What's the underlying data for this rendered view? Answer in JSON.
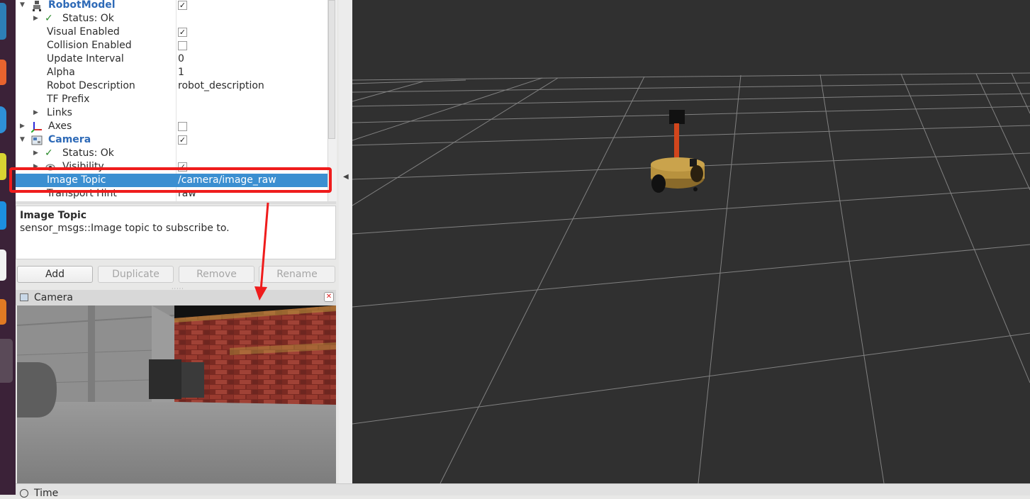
{
  "displays": {
    "rows": [
      {
        "indent": 0,
        "expanded": true,
        "name": "RobotModel",
        "bold": true,
        "icon": "robot-model-icon",
        "checked": true
      },
      {
        "indent": 1,
        "expanded": false,
        "name": "Status: Ok",
        "status": true
      },
      {
        "indent": 1,
        "name": "Visual Enabled",
        "checked": true
      },
      {
        "indent": 1,
        "name": "Collision Enabled",
        "checked": false
      },
      {
        "indent": 1,
        "name": "Update Interval",
        "value": "0"
      },
      {
        "indent": 1,
        "name": "Alpha",
        "value": "1"
      },
      {
        "indent": 1,
        "name": "Robot Description",
        "value": "robot_description"
      },
      {
        "indent": 1,
        "name": "TF Prefix",
        "value": ""
      },
      {
        "indent": 1,
        "expanded": false,
        "name": "Links"
      },
      {
        "indent": 0,
        "expanded": false,
        "name": "Axes",
        "icon": "axes-icon",
        "checked": false
      },
      {
        "indent": 0,
        "expanded": true,
        "name": "Camera",
        "bold": true,
        "icon": "camera-icon",
        "checked": true
      },
      {
        "indent": 1,
        "expanded": false,
        "name": "Status: Ok",
        "status": true
      },
      {
        "indent": 1,
        "expanded": false,
        "name": "Visibility",
        "icon": "eye-icon",
        "checked": true
      },
      {
        "indent": 1,
        "name": "Image Topic",
        "value": "/camera/image_raw",
        "selected": true
      },
      {
        "indent": 1,
        "name": "Transport Hint",
        "value": "raw"
      }
    ]
  },
  "description": {
    "title": "Image Topic",
    "text": "sensor_msgs::Image topic to subscribe to."
  },
  "buttons": {
    "add": "Add",
    "duplicate": "Duplicate",
    "remove": "Remove",
    "rename": "Rename"
  },
  "camera_panel": {
    "title": "Camera"
  },
  "bottom_bar": {
    "time_label": "Time"
  },
  "colors": {
    "selection": "#3b8fd1",
    "annotation": "#ef1c1c",
    "grid_background": "#303030",
    "grid_lines": "#a0a0a0"
  }
}
